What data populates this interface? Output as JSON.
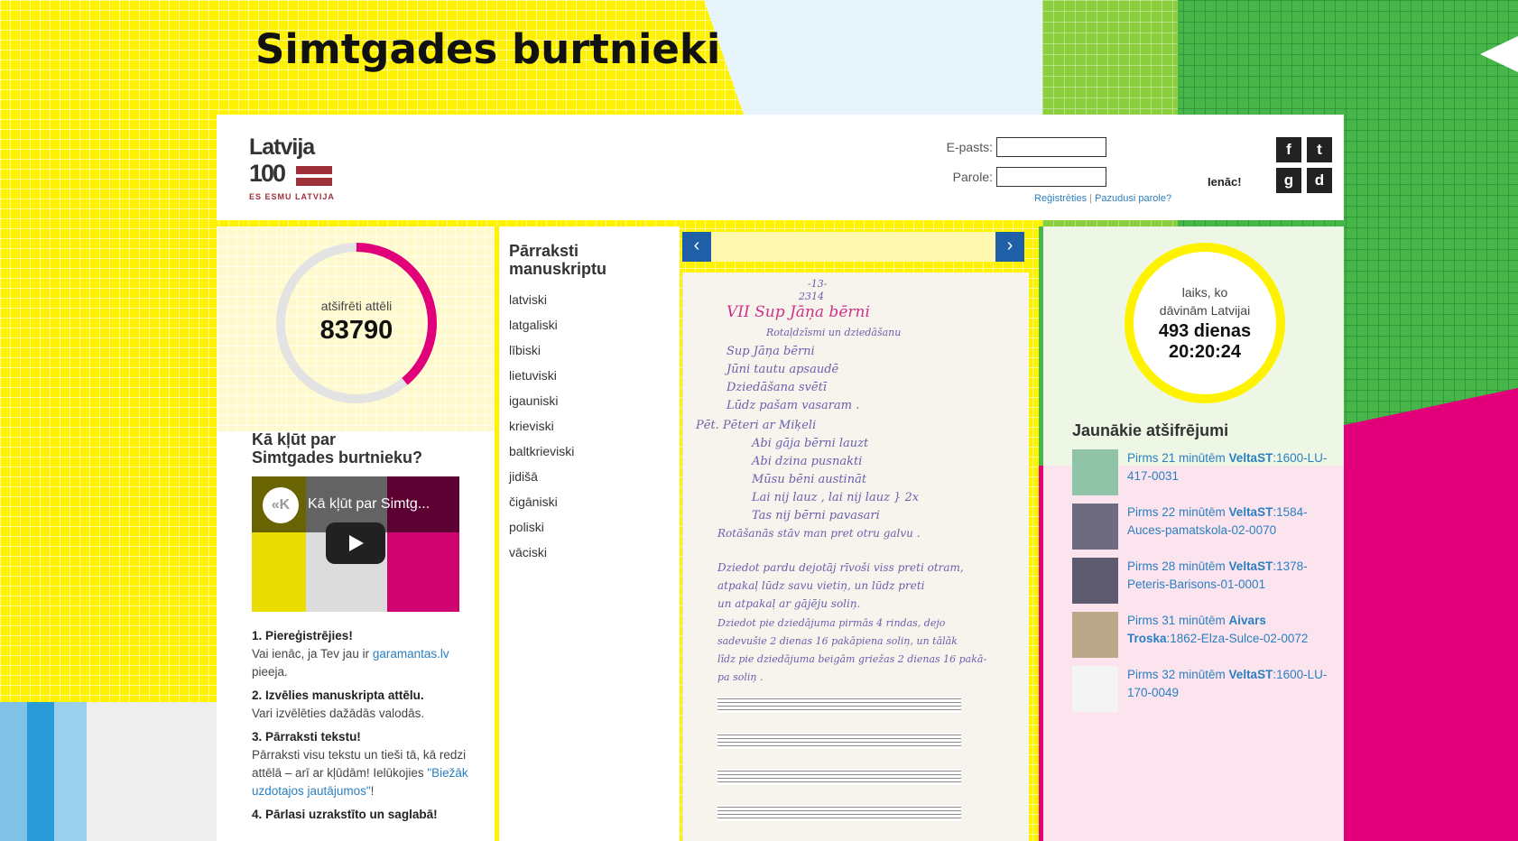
{
  "site": {
    "title": "Simtgades burtnieki"
  },
  "logo": {
    "word": "Latvija",
    "number": "100",
    "tagline": "ES ESMU LATVIJA"
  },
  "login": {
    "email_label": "E-pasts:",
    "password_label": "Parole:",
    "email_value": "",
    "password_value": "",
    "register_link": "Reģistrēties",
    "separator": "|",
    "forgot_link": "Pazudusi parole?",
    "submit_label": "Ienāc!"
  },
  "social": [
    {
      "icon": "facebook-icon",
      "glyph": "f"
    },
    {
      "icon": "twitter-icon",
      "glyph": "t"
    },
    {
      "icon": "google-icon",
      "glyph": "g"
    },
    {
      "icon": "draugiem-icon",
      "glyph": "d"
    }
  ],
  "progress": {
    "label": "atšifrēti attēli",
    "value": "83790",
    "fraction": 0.39,
    "color": "#e2007a"
  },
  "howto": {
    "title_line1": "Kā kļūt par",
    "title_line2": "Simtgades burtnieku?",
    "video_title": "Kā kļūt par Simtg...",
    "steps": [
      {
        "title": "1. Piereģistrējies!",
        "text_before": "Vai ienāc, ja Tev jau ir",
        "link": "garamantas.lv",
        "text_after": "pieeja."
      },
      {
        "title": "2. Izvēlies manuskripta attēlu.",
        "text": "Vari izvēlēties dažādās valodās."
      },
      {
        "title": "3. Pārraksti tekstu!",
        "text_before": "Pārraksti visu tekstu un tieši tā, kā redzi attēlā – arī ar kļūdām! Ielūkojies",
        "link": "\"Biežāk uzdotajos jautājumos\"",
        "text_after": "!"
      },
      {
        "title": "4. Pārlasi uzrakstīto un saglabā!"
      }
    ]
  },
  "languages": {
    "title_line1": "Pārraksti",
    "title_line2": "manuskriptu",
    "items": [
      "latviski",
      "latgaliski",
      "lībiski",
      "lietuviski",
      "igauniski",
      "krieviski",
      "baltkrieviski",
      "jidišā",
      "čigāniski",
      "poliski",
      "vāciski"
    ]
  },
  "viewer": {
    "prev": "‹",
    "next": "›",
    "manuscript_lines": [
      "-13-",
      "2314",
      "VII   Sup  Jāņa  bērni",
      "Rotaļdzīsmi un dziedāšanu",
      "Sup Jāņa bērni",
      "Jūni tautu apsaudē",
      "Dziedāšana  svētī",
      "Lūdz  pašam  vasaram .",
      "Pēt.   Pēteri  ar  Miķeli",
      "Abi  gāja  bērni  lauzt",
      "Abi  dzina  pusnakti",
      "Mūsu  bēni  austināt",
      "Lai  nij  lauz ,  lai  nij  lauz  } 2x",
      "Tas  nij  bērni  pavasari",
      "Rotāšanās  stāv  man  pret  otru  galvu .",
      "Dziedot  pardu  dejotāj  rīvoši  viss  preti  otram,",
      "atpakaļ  lūdz  savu  vietiņ,  un  lūdz  preti",
      "un  atpakaļ  ar  gājēju  soliņ.",
      "Dziedot  pie  dziedājuma  pirmās  4  rindas,  dejo",
      "sadevušie  2  dienas  16  pakāpiena  soliņ,  un  tālāk",
      "līdz  pie  dziedājuma  beigām  griežas  2  dienas  16  pakā-",
      "pa  soliņ ."
    ]
  },
  "timer": {
    "label_line1": "laiks, ko",
    "label_line2": "dāvinām Latvijai",
    "days": "493 dienas",
    "time": "20:20:24",
    "color": "#fff200"
  },
  "latest": {
    "title": "Jaunākie atšifrējumi",
    "items": [
      {
        "time": "Pirms 21 minūtēm",
        "user": "VeltaST",
        "item": ":1600-LU-417-0031",
        "thumb": "#8fc4a8"
      },
      {
        "time": "Pirms 22 minūtēm",
        "user": "VeltaST",
        "item": ":1584-Auces-pamatskola-02-0070",
        "thumb": "#6e6a80"
      },
      {
        "time": "Pirms 28 minūtēm",
        "user": "VeltaST",
        "item": ":1378-Peteris-Barisons-01-0001",
        "thumb": "#5e5a70"
      },
      {
        "time": "Pirms 31 minūtēm",
        "user": "Aivars Troska",
        "item": ":1862-Elza-Sulce-02-0072",
        "thumb": "#b9a98a"
      },
      {
        "time": "Pirms 32 minūtēm",
        "user": "VeltaST",
        "item": ":1600-LU-170-0049",
        "thumb": "#f4f4f4"
      }
    ]
  }
}
